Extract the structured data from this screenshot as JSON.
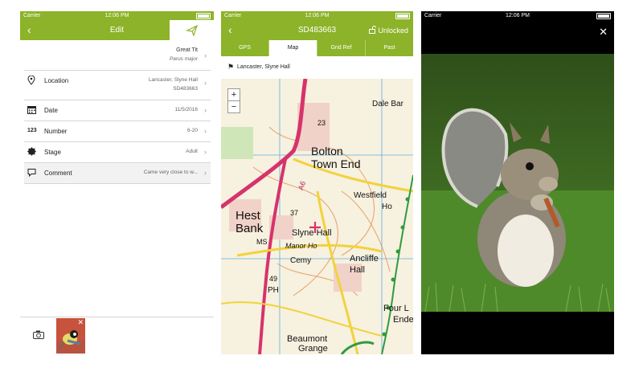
{
  "screen1": {
    "status": {
      "carrier": "Carrier",
      "time": "12:06 PM"
    },
    "nav": {
      "title": "Edit"
    },
    "species": {
      "common": "Great Tit",
      "latin": "Parus major"
    },
    "rows": [
      {
        "label": "Location",
        "value": "Lancaster, Slyne Hall",
        "value2": "SD483663"
      },
      {
        "label": "Date",
        "value": "11/5/2016"
      },
      {
        "label": "Number",
        "icon_text": "123",
        "value": "6-20"
      },
      {
        "label": "Stage",
        "value": "Adult"
      },
      {
        "label": "Comment",
        "value": "Came very close to w..."
      }
    ]
  },
  "screen2": {
    "status": {
      "carrier": "Carrier",
      "time": "12:06 PM"
    },
    "nav": {
      "title": "SD483663",
      "lock_label": "Unlocked"
    },
    "tabs": [
      "GPS",
      "Map",
      "Grid Ref",
      "Past"
    ],
    "active_tab": "Map",
    "location": "Lancaster, Slyne Hall",
    "map_labels": {
      "dale": "Dale Bar",
      "bolton": "Bolton",
      "town_end": "Town End",
      "westfield": "Westfield",
      "ho": "Ho",
      "hest": "Hest",
      "bank": "Bank",
      "slyne_hall": "Slyne Hall",
      "manor_ho": "Manor Ho",
      "ms": "MS",
      "cemy": "Cemy",
      "ancliffe": "Ancliffe",
      "hall": "Hall",
      "four_l": "Four L",
      "ende": "Ende",
      "beaumont": "Beaumont",
      "grange": "Grange",
      "ph": "PH",
      "a6": "A6",
      "n23": "23",
      "n37": "37",
      "n49": "49"
    }
  },
  "screen3": {
    "status": {
      "carrier": "Carrier",
      "time": "12:06 PM"
    }
  },
  "colors": {
    "brand": "#8cb329",
    "map_road": "#d6336c",
    "map_grid": "#5bb0e0"
  }
}
